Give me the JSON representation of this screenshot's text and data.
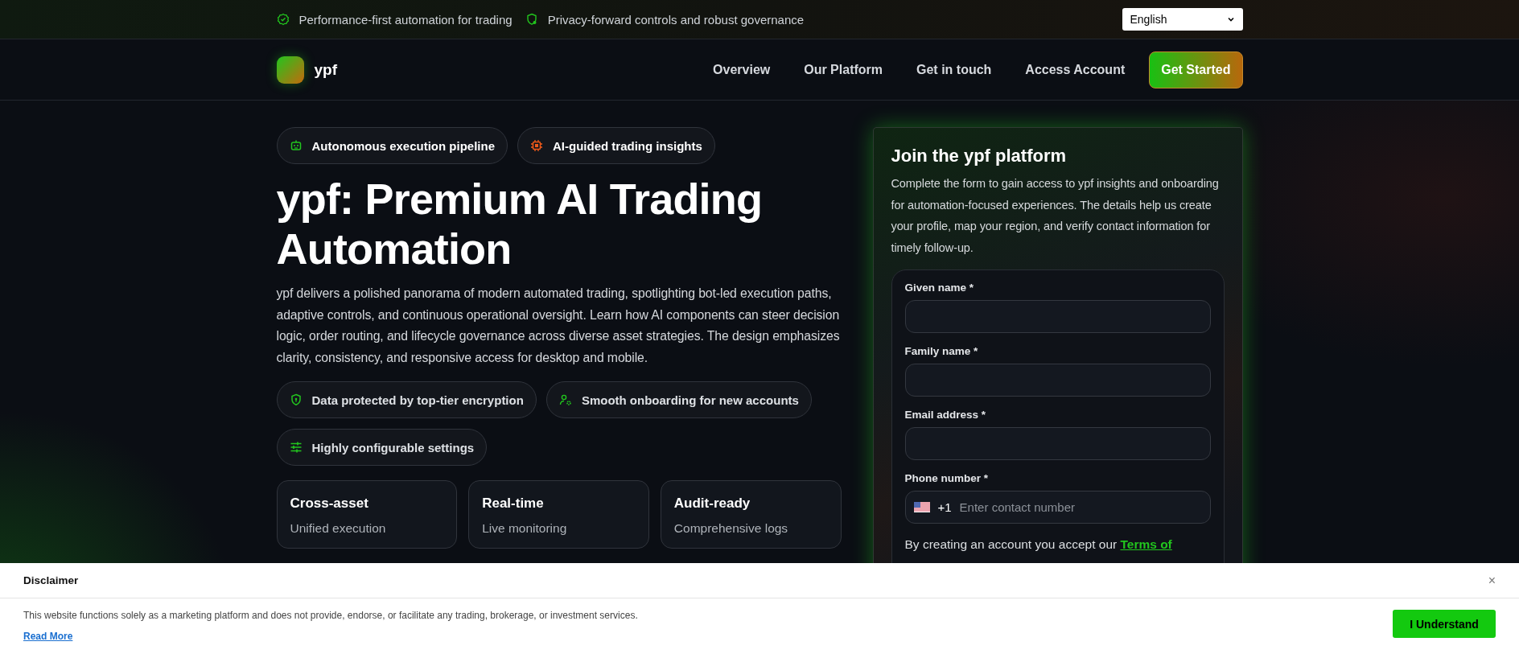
{
  "top_bar": {
    "items": [
      "Performance-first automation for trading",
      "Privacy-forward controls and robust governance"
    ],
    "language": "English"
  },
  "nav": {
    "brand": "ypf",
    "links": [
      "Overview",
      "Our Platform",
      "Get in touch",
      "Access Account"
    ],
    "cta": "Get Started"
  },
  "hero": {
    "badges": [
      "Autonomous execution pipeline",
      "AI-guided trading insights"
    ],
    "title": "ypf: Premium AI Trading Automation",
    "description": "ypf delivers a polished panorama of modern automated trading, spotlighting bot-led execution paths, adaptive controls, and continuous operational oversight. Learn how AI components can steer decision logic, order routing, and lifecycle governance across diverse asset strategies. The design emphasizes clarity, consistency, and responsive access for desktop and mobile.",
    "features": [
      "Data protected by top-tier encryption",
      "Smooth onboarding for new accounts",
      "Highly configurable settings"
    ],
    "stats": [
      {
        "title": "Cross-asset",
        "subtitle": "Unified execution"
      },
      {
        "title": "Real-time",
        "subtitle": "Live monitoring"
      },
      {
        "title": "Audit-ready",
        "subtitle": "Comprehensive logs"
      }
    ]
  },
  "signup": {
    "title": "Join the ypf platform",
    "description": "Complete the form to gain access to ypf insights and onboarding for automation-focused experiences. The details help us create your profile, map your region, and verify contact information for timely follow-up.",
    "fields": [
      {
        "kind": "text",
        "label": "Given name *"
      },
      {
        "kind": "text",
        "label": "Family name *"
      },
      {
        "kind": "text",
        "label": "Email address *"
      },
      {
        "kind": "phone",
        "label": "Phone number *",
        "dial_code": "+1",
        "placeholder": "Enter contact number"
      }
    ],
    "terms": {
      "text": "By creating an account you accept our",
      "link": "Terms of"
    }
  },
  "disclaimer": {
    "title": "Disclaimer",
    "text": "This website functions solely as a marketing platform and does not provide, endorse, or facilitate any trading, brokerage, or investment services.",
    "link": "Read More",
    "close": "×",
    "button": "I Understand"
  }
}
